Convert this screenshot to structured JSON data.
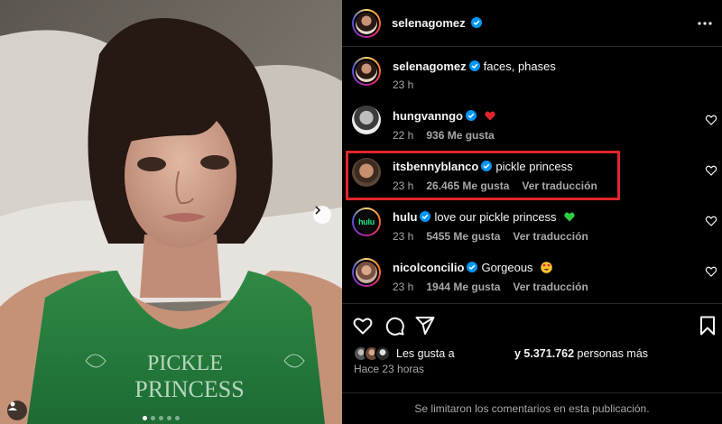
{
  "post": {
    "author": "selenagomez",
    "more_icon": "more-horizontal-icon",
    "carousel": {
      "slides": 5,
      "active_slide": 1
    },
    "caption": {
      "username": "selenagomez",
      "text": "faces, phases",
      "time": "23 h"
    },
    "shirt_text": [
      "PICKLE",
      "PRINCESS"
    ]
  },
  "comments": [
    {
      "username": "hungvanngo",
      "verified": true,
      "text": "",
      "emoji": "red-heart",
      "time": "22 h",
      "likes": "936 Me gusta",
      "translate": ""
    },
    {
      "username": "itsbennyblanco",
      "verified": true,
      "text": "pickle princess",
      "emoji": "",
      "time": "23 h",
      "likes": "26.465 Me gusta",
      "translate": "Ver traducción",
      "highlighted": true
    },
    {
      "username": "hulu",
      "verified": true,
      "text": "love our pickle princess",
      "emoji": "green-heart",
      "time": "23 h",
      "likes": "5455 Me gusta",
      "translate": "Ver traducción"
    },
    {
      "username": "nicolconcilio",
      "verified": true,
      "text": "Gorgeous",
      "emoji": "heart-eyes",
      "time": "23 h",
      "likes": "1944 Me gusta",
      "translate": "Ver traducción"
    }
  ],
  "hulu_logo": "hulu",
  "likes": {
    "prefix": "Les gusta a",
    "count": "y 5.371.762",
    "suffix": "personas más"
  },
  "posted": "Hace 23 horas",
  "footer": "Se limitaron los comentarios en esta publicación.",
  "colors": {
    "verified": "#0095f6",
    "highlight": "#e0262a",
    "hulu_green": "#1ce783",
    "background": "#000000",
    "muted": "#a8a8a8"
  }
}
